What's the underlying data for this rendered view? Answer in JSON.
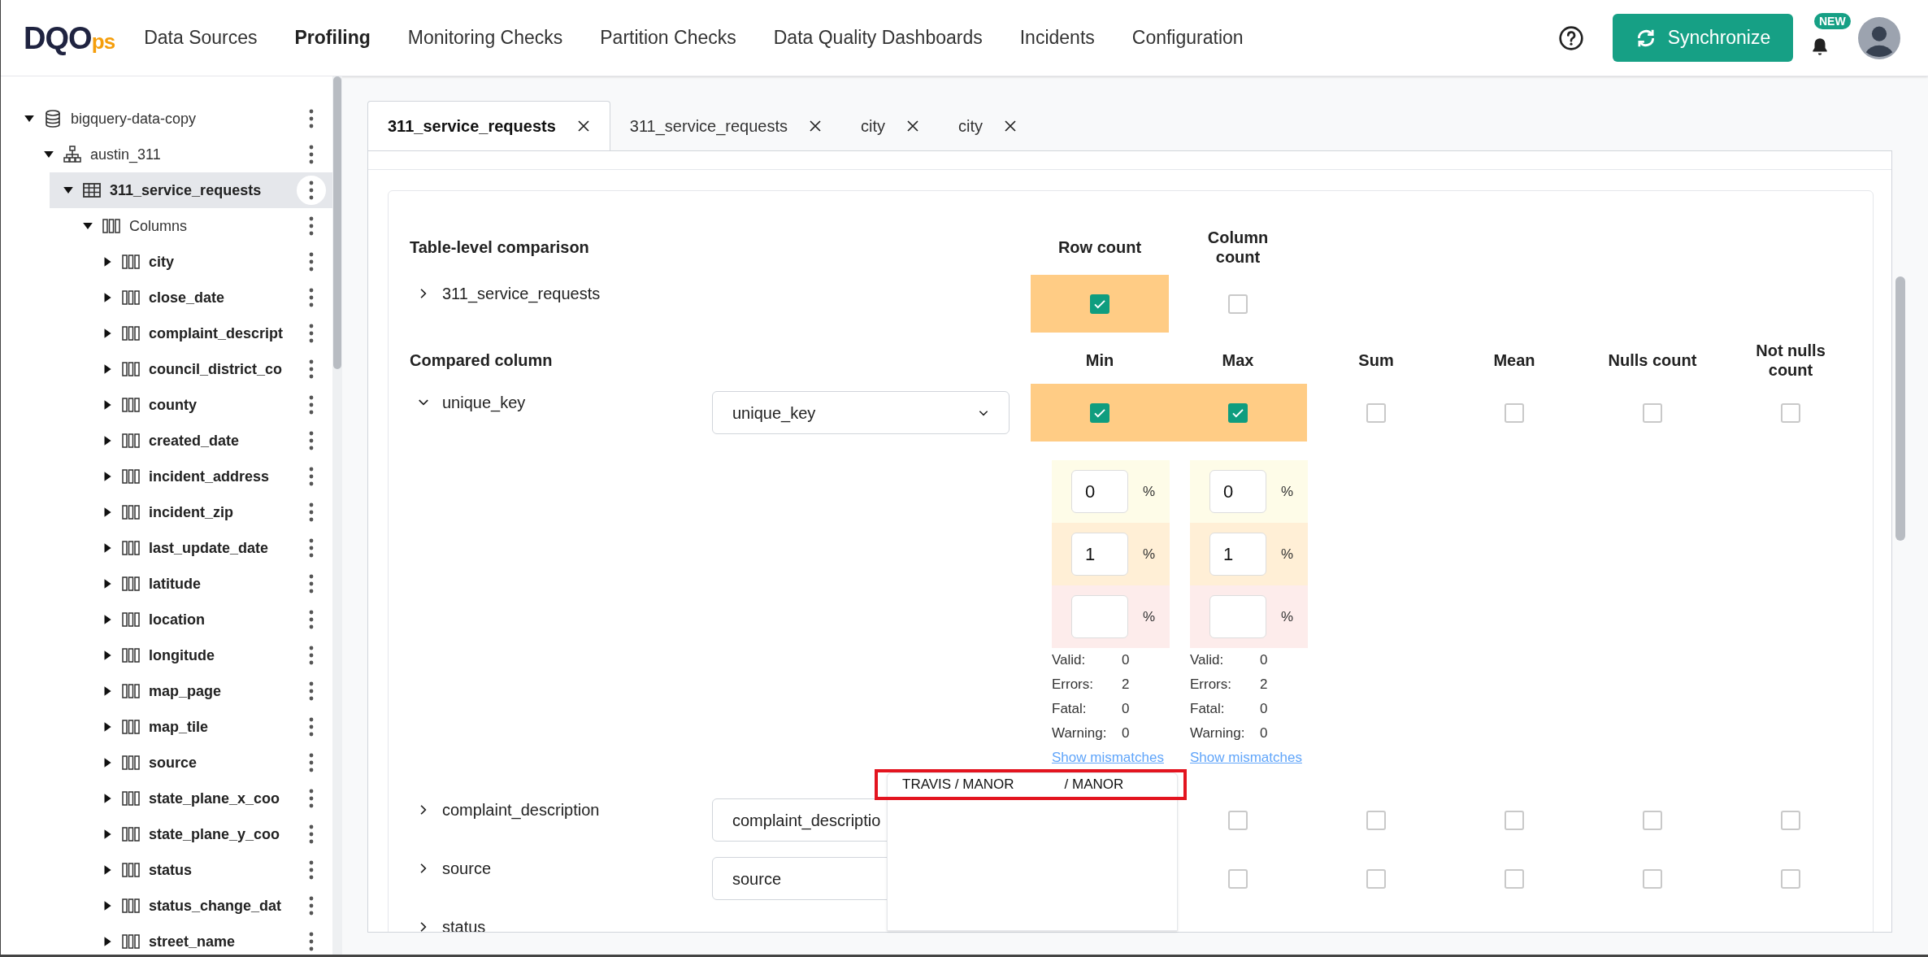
{
  "header": {
    "logo": {
      "main": "DQO",
      "suffix": "ps"
    },
    "nav": [
      {
        "label": "Data Sources",
        "selected": false
      },
      {
        "label": "Profiling",
        "selected": true
      },
      {
        "label": "Monitoring Checks",
        "selected": false
      },
      {
        "label": "Partition Checks",
        "selected": false
      },
      {
        "label": "Data Quality Dashboards",
        "selected": false
      },
      {
        "label": "Incidents",
        "selected": false
      },
      {
        "label": "Configuration",
        "selected": false
      }
    ],
    "sync_button": "Synchronize",
    "notification_badge": "NEW"
  },
  "sidebar": {
    "tree": [
      {
        "kind": "connection",
        "label": "bigquery-data-copy",
        "expanded": true,
        "selected": false,
        "children": [
          {
            "kind": "schema",
            "label": "austin_311",
            "expanded": true,
            "selected": false,
            "children": [
              {
                "kind": "table",
                "label": "311_service_requests",
                "expanded": true,
                "selected": true,
                "children": [
                  {
                    "kind": "folder",
                    "label": "Columns",
                    "expanded": true,
                    "selected": false,
                    "children": [
                      {
                        "kind": "column",
                        "label": "city",
                        "expanded": false,
                        "selected": false
                      },
                      {
                        "kind": "column",
                        "label": "close_date",
                        "expanded": false,
                        "selected": false
                      },
                      {
                        "kind": "column",
                        "label": "complaint_descript",
                        "expanded": false,
                        "selected": false
                      },
                      {
                        "kind": "column",
                        "label": "council_district_co",
                        "expanded": false,
                        "selected": false
                      },
                      {
                        "kind": "column",
                        "label": "county",
                        "expanded": false,
                        "selected": false
                      },
                      {
                        "kind": "column",
                        "label": "created_date",
                        "expanded": false,
                        "selected": false
                      },
                      {
                        "kind": "column",
                        "label": "incident_address",
                        "expanded": false,
                        "selected": false
                      },
                      {
                        "kind": "column",
                        "label": "incident_zip",
                        "expanded": false,
                        "selected": false
                      },
                      {
                        "kind": "column",
                        "label": "last_update_date",
                        "expanded": false,
                        "selected": false
                      },
                      {
                        "kind": "column",
                        "label": "latitude",
                        "expanded": false,
                        "selected": false
                      },
                      {
                        "kind": "column",
                        "label": "location",
                        "expanded": false,
                        "selected": false
                      },
                      {
                        "kind": "column",
                        "label": "longitude",
                        "expanded": false,
                        "selected": false
                      },
                      {
                        "kind": "column",
                        "label": "map_page",
                        "expanded": false,
                        "selected": false
                      },
                      {
                        "kind": "column",
                        "label": "map_tile",
                        "expanded": false,
                        "selected": false
                      },
                      {
                        "kind": "column",
                        "label": "source",
                        "expanded": false,
                        "selected": false
                      },
                      {
                        "kind": "column",
                        "label": "state_plane_x_coo",
                        "expanded": false,
                        "selected": false
                      },
                      {
                        "kind": "column",
                        "label": "state_plane_y_coo",
                        "expanded": false,
                        "selected": false
                      },
                      {
                        "kind": "column",
                        "label": "status",
                        "expanded": false,
                        "selected": false
                      },
                      {
                        "kind": "column",
                        "label": "status_change_dat",
                        "expanded": false,
                        "selected": false
                      },
                      {
                        "kind": "column",
                        "label": "street_name",
                        "expanded": false,
                        "selected": false
                      }
                    ]
                  }
                ]
              }
            ]
          }
        ]
      }
    ]
  },
  "tabs": [
    {
      "label": "311_service_requests",
      "selected": true
    },
    {
      "label": "311_service_requests",
      "selected": false
    },
    {
      "label": "city",
      "selected": false
    },
    {
      "label": "city",
      "selected": false
    }
  ],
  "comparison": {
    "table_section": {
      "title": "Table-level comparison",
      "columns": [
        "Row count",
        "Column count"
      ],
      "rows": [
        {
          "name": "311_service_requests",
          "expanded": false,
          "checks": [
            {
              "kind": "checkbox",
              "checked": true
            },
            {
              "kind": "checkbox",
              "checked": false
            }
          ]
        }
      ]
    },
    "column_section": {
      "title": "Compared column",
      "columns": [
        "Min",
        "Max",
        "Sum",
        "Mean",
        "Nulls count",
        "Not nulls count"
      ],
      "rows": [
        {
          "name": "unique_key",
          "expanded": true,
          "reference": "unique_key",
          "checks": [
            {
              "kind": "checkbox",
              "checked": true,
              "thresholds": [
                {
                  "color": "#fefce8",
                  "value": "0",
                  "unit": "%"
                },
                {
                  "color": "#ffefd6",
                  "value": "1",
                  "unit": "%"
                },
                {
                  "color": "#fdeceb",
                  "unit": "%"
                }
              ],
              "results": [
                {
                  "label": "Valid:",
                  "value": "0"
                },
                {
                  "label": "Errors:",
                  "value": "2"
                },
                {
                  "label": "Fatal:",
                  "value": "0"
                },
                {
                  "label": "Warning:",
                  "value": "0"
                }
              ],
              "link": "Show mismatches"
            },
            {
              "kind": "checkbox",
              "checked": true,
              "thresholds": [
                {
                  "color": "#fefce8",
                  "value": "0",
                  "unit": "%"
                },
                {
                  "color": "#ffefd6",
                  "value": "1",
                  "unit": "%"
                },
                {
                  "color": "#fdeceb",
                  "unit": "%"
                }
              ],
              "results": [
                {
                  "label": "Valid:",
                  "value": "0"
                },
                {
                  "label": "Errors:",
                  "value": "2"
                },
                {
                  "label": "Fatal:",
                  "value": "0"
                },
                {
                  "label": "Warning:",
                  "value": "0"
                }
              ],
              "link": "Show mismatches"
            },
            {
              "kind": "checkbox",
              "checked": false
            },
            {
              "kind": "checkbox",
              "checked": false
            },
            {
              "kind": "checkbox",
              "checked": false
            },
            {
              "kind": "checkbox",
              "checked": false
            }
          ]
        },
        {
          "name": "complaint_description",
          "expanded": false,
          "reference": "complaint_descriptio",
          "checks": [
            {
              "kind": "covered"
            },
            {
              "kind": "checkbox",
              "checked": false
            },
            {
              "kind": "checkbox",
              "checked": false
            },
            {
              "kind": "checkbox",
              "checked": false
            },
            {
              "kind": "checkbox",
              "checked": false
            },
            {
              "kind": "checkbox",
              "checked": false
            }
          ]
        },
        {
          "name": "source",
          "expanded": false,
          "reference": "source",
          "checks": [
            {
              "kind": "covered"
            },
            {
              "kind": "checkbox",
              "checked": false
            },
            {
              "kind": "checkbox",
              "checked": false
            },
            {
              "kind": "checkbox",
              "checked": false
            },
            {
              "kind": "checkbox",
              "checked": false
            },
            {
              "kind": "checkbox",
              "checked": false
            }
          ]
        },
        {
          "name": "status",
          "expanded": false
        }
      ]
    }
  },
  "popup": {
    "items": [
      "TRAVIS / MANOR",
      "/ MANOR"
    ]
  }
}
